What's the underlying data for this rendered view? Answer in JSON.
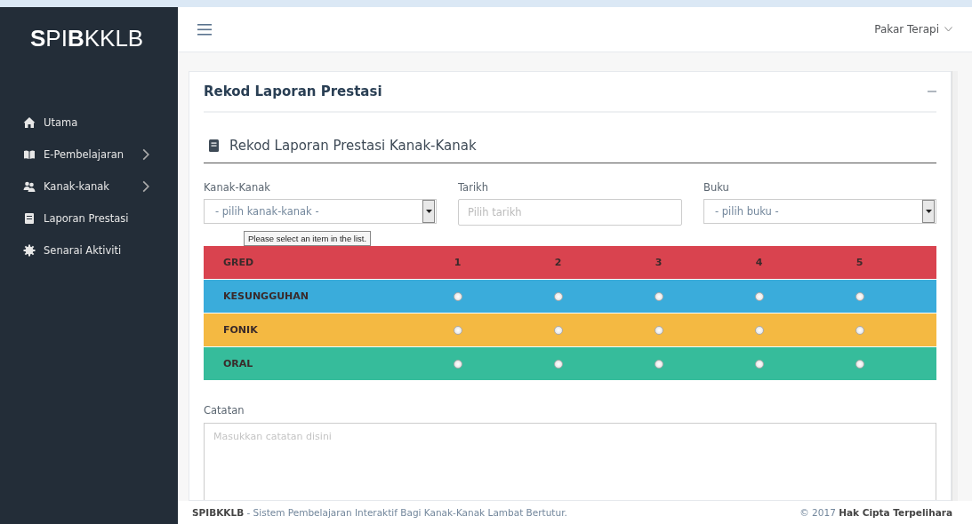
{
  "sidebar": {
    "logo": "**S**PI**B**KKLB",
    "items": [
      {
        "label": "Utama",
        "has_submenu": false
      },
      {
        "label": "E-Pembelajaran",
        "has_submenu": true
      },
      {
        "label": "Kanak-kanak",
        "has_submenu": true
      },
      {
        "label": "Laporan Prestasi",
        "has_submenu": false
      },
      {
        "label": "Senarai Aktiviti",
        "has_submenu": false
      }
    ]
  },
  "topbar": {
    "user": "Pakar Terapi"
  },
  "panel": {
    "title": "Rekod Laporan Prestasi",
    "section_title": "Rekod Laporan Prestasi Kanak-Kanak",
    "fields": [
      {
        "kind": "select",
        "label": "Kanak-Kanak",
        "value": "- pilih kanak-kanak -",
        "tooltip": "Please select an item in the list."
      },
      {
        "kind": "text",
        "label": "Tarikh",
        "placeholder": "Pilih tarikh"
      },
      {
        "kind": "select",
        "label": "Buku",
        "value": "- pilih buku -"
      }
    ],
    "grade_table": {
      "columns": [
        "GRED",
        "1",
        "2",
        "3",
        "4",
        "5"
      ],
      "rows": [
        {
          "label": "KESUNGGUHAN",
          "color": "#3aacdb",
          "checked": [
            false,
            false,
            false,
            false,
            false
          ]
        },
        {
          "label": "FONIK",
          "color": "#f4b942",
          "checked": [
            false,
            false,
            false,
            false,
            false
          ]
        },
        {
          "label": "ORAL",
          "color": "#36bc9b",
          "checked": [
            false,
            false,
            false,
            false,
            false
          ]
        }
      ]
    },
    "notes": {
      "label": "Catatan",
      "placeholder": "Masukkan catatan disini"
    }
  },
  "footer": {
    "left": "**SPIBKKLB** - Sistem Pembelajaran Interaktif Bagi Kanak-Kanak Lambat Bertutur.",
    "right": "© 2017 **Hak Cipta Terpelihara**"
  }
}
